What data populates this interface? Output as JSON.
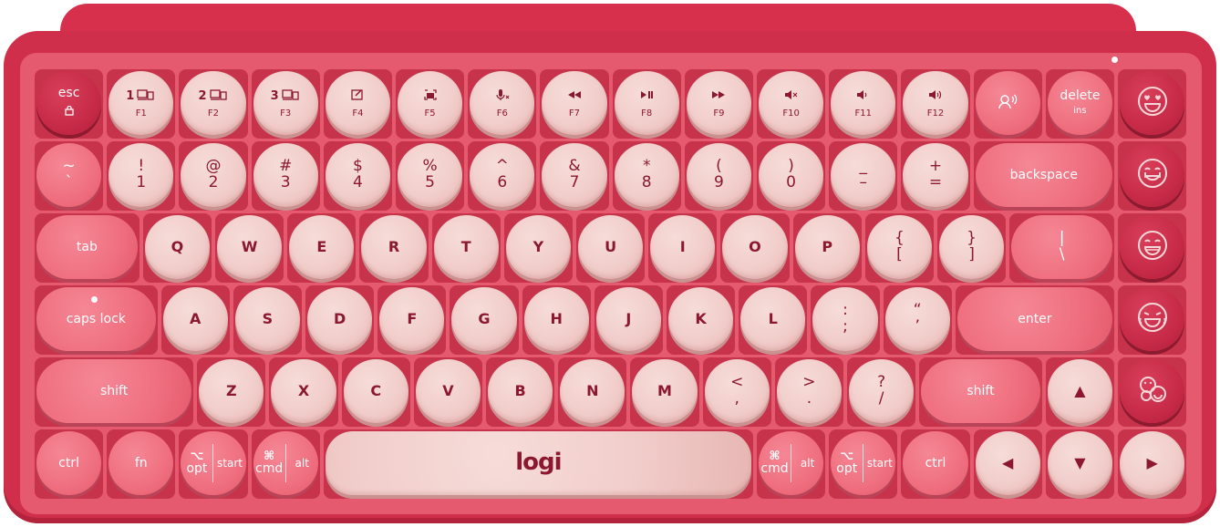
{
  "logo_text": "logi",
  "rows": [
    [
      {
        "id": "esc",
        "main": "esc",
        "sub": "",
        "icon": "lock-icon",
        "style": "dark",
        "w": 1
      },
      {
        "id": "f1",
        "main": "1",
        "sub": "F1",
        "icon": "device-icon",
        "style": "light",
        "w": 1
      },
      {
        "id": "f2",
        "main": "2",
        "sub": "F2",
        "icon": "device-icon",
        "style": "light",
        "w": 1
      },
      {
        "id": "f3",
        "main": "3",
        "sub": "F3",
        "icon": "device-icon",
        "style": "light",
        "w": 1
      },
      {
        "id": "f4",
        "main": "",
        "sub": "F4",
        "icon": "edit-icon",
        "style": "light",
        "w": 1
      },
      {
        "id": "f5",
        "main": "",
        "sub": "F5",
        "icon": "screenshot-icon",
        "style": "light",
        "w": 1
      },
      {
        "id": "f6",
        "main": "",
        "sub": "F6",
        "icon": "mic-mute-icon",
        "style": "light",
        "w": 1
      },
      {
        "id": "f7",
        "main": "",
        "sub": "F7",
        "icon": "rewind-icon",
        "style": "light",
        "w": 1
      },
      {
        "id": "f8",
        "main": "",
        "sub": "F8",
        "icon": "play-pause-icon",
        "style": "light",
        "w": 1
      },
      {
        "id": "f9",
        "main": "",
        "sub": "F9",
        "icon": "fast-forward-icon",
        "style": "light",
        "w": 1
      },
      {
        "id": "f10",
        "main": "",
        "sub": "F10",
        "icon": "mute-icon",
        "style": "light",
        "w": 1
      },
      {
        "id": "f11",
        "main": "",
        "sub": "F11",
        "icon": "volume-down-icon",
        "style": "light",
        "w": 1
      },
      {
        "id": "f12",
        "main": "",
        "sub": "F12",
        "icon": "volume-up-icon",
        "style": "light",
        "w": 1
      },
      {
        "id": "dictation",
        "main": "",
        "sub": "",
        "icon": "dictation-icon",
        "style": "coral",
        "w": 1
      },
      {
        "id": "delete",
        "main": "delete",
        "sub": "ins",
        "icon": "",
        "style": "coral",
        "w": 1
      },
      {
        "id": "emoji1",
        "main": "",
        "sub": "",
        "icon": "heart-eyes-emoji-icon",
        "style": "dark",
        "w": 1
      }
    ],
    [
      {
        "id": "tilde",
        "main": "~",
        "sub": "`",
        "style": "coral",
        "w": 1,
        "stack": true
      },
      {
        "id": "k1",
        "main": "!",
        "sub": "1",
        "style": "light",
        "w": 1,
        "stack": true
      },
      {
        "id": "k2",
        "main": "@",
        "sub": "2",
        "style": "light",
        "w": 1,
        "stack": true
      },
      {
        "id": "k3",
        "main": "#",
        "sub": "3",
        "style": "light",
        "w": 1,
        "stack": true
      },
      {
        "id": "k4",
        "main": "$",
        "sub": "4",
        "style": "light",
        "w": 1,
        "stack": true
      },
      {
        "id": "k5",
        "main": "%",
        "sub": "5",
        "style": "light",
        "w": 1,
        "stack": true
      },
      {
        "id": "k6",
        "main": "^",
        "sub": "6",
        "style": "light",
        "w": 1,
        "stack": true
      },
      {
        "id": "k7",
        "main": "&",
        "sub": "7",
        "style": "light",
        "w": 1,
        "stack": true
      },
      {
        "id": "k8",
        "main": "*",
        "sub": "8",
        "style": "light",
        "w": 1,
        "stack": true
      },
      {
        "id": "k9",
        "main": "(",
        "sub": "9",
        "style": "light",
        "w": 1,
        "stack": true
      },
      {
        "id": "k0",
        "main": ")",
        "sub": "0",
        "style": "light",
        "w": 1,
        "stack": true
      },
      {
        "id": "minus",
        "main": "_",
        "sub": "–",
        "style": "light",
        "w": 1,
        "stack": true
      },
      {
        "id": "equal",
        "main": "+",
        "sub": "=",
        "style": "light",
        "w": 1,
        "stack": true
      },
      {
        "id": "backspace",
        "main": "backspace",
        "sub": "",
        "style": "coral",
        "w": 2
      },
      {
        "id": "emoji2",
        "main": "",
        "sub": "",
        "icon": "tear-smile-emoji-icon",
        "style": "dark",
        "w": 1
      }
    ],
    [
      {
        "id": "tab",
        "main": "tab",
        "sub": "",
        "style": "coral",
        "w": 1.5
      },
      {
        "id": "q",
        "main": "Q",
        "style": "light",
        "w": 1
      },
      {
        "id": "w",
        "main": "W",
        "style": "light",
        "w": 1
      },
      {
        "id": "e",
        "main": "E",
        "style": "light",
        "w": 1
      },
      {
        "id": "r",
        "main": "R",
        "style": "light",
        "w": 1
      },
      {
        "id": "t",
        "main": "T",
        "style": "light",
        "w": 1
      },
      {
        "id": "y",
        "main": "Y",
        "style": "light",
        "w": 1
      },
      {
        "id": "u",
        "main": "U",
        "style": "light",
        "w": 1
      },
      {
        "id": "i",
        "main": "I",
        "style": "light",
        "w": 1
      },
      {
        "id": "o",
        "main": "O",
        "style": "light",
        "w": 1
      },
      {
        "id": "p",
        "main": "P",
        "style": "light",
        "w": 1
      },
      {
        "id": "lbracket",
        "main": "{",
        "sub": "[",
        "style": "light",
        "w": 1,
        "stack": true
      },
      {
        "id": "rbracket",
        "main": "}",
        "sub": "]",
        "style": "light",
        "w": 1,
        "stack": true
      },
      {
        "id": "backslash",
        "main": "|",
        "sub": "\\",
        "style": "coral",
        "w": 1.5,
        "stack": true
      },
      {
        "id": "emoji3",
        "main": "",
        "sub": "",
        "icon": "grin-emoji-icon",
        "style": "dark",
        "w": 1
      }
    ],
    [
      {
        "id": "capslock",
        "main": "caps lock",
        "sub": "",
        "style": "coral",
        "w": 1.75
      },
      {
        "id": "a",
        "main": "A",
        "style": "light",
        "w": 1
      },
      {
        "id": "s",
        "main": "S",
        "style": "light",
        "w": 1
      },
      {
        "id": "d",
        "main": "D",
        "style": "light",
        "w": 1
      },
      {
        "id": "f",
        "main": "F",
        "style": "light",
        "w": 1
      },
      {
        "id": "g",
        "main": "G",
        "style": "light",
        "w": 1
      },
      {
        "id": "h",
        "main": "H",
        "style": "light",
        "w": 1
      },
      {
        "id": "j",
        "main": "J",
        "style": "light",
        "w": 1
      },
      {
        "id": "k",
        "main": "K",
        "style": "light",
        "w": 1
      },
      {
        "id": "l",
        "main": "L",
        "style": "light",
        "w": 1
      },
      {
        "id": "semicolon",
        "main": ":",
        "sub": ";",
        "style": "light",
        "w": 1,
        "stack": true
      },
      {
        "id": "quote",
        "main": "“",
        "sub": "’",
        "style": "light",
        "w": 1,
        "stack": true
      },
      {
        "id": "enter",
        "main": "enter",
        "sub": "",
        "style": "coral",
        "w": 2.25
      },
      {
        "id": "emoji4",
        "main": "",
        "sub": "",
        "icon": "joy-emoji-icon",
        "style": "dark",
        "w": 1
      }
    ],
    [
      {
        "id": "lshift",
        "main": "shift",
        "sub": "",
        "style": "coral",
        "w": 2.25
      },
      {
        "id": "z",
        "main": "Z",
        "style": "light",
        "w": 1
      },
      {
        "id": "x",
        "main": "X",
        "style": "light",
        "w": 1
      },
      {
        "id": "c",
        "main": "C",
        "style": "light",
        "w": 1
      },
      {
        "id": "v",
        "main": "V",
        "style": "light",
        "w": 1
      },
      {
        "id": "b",
        "main": "B",
        "style": "light",
        "w": 1
      },
      {
        "id": "n",
        "main": "N",
        "style": "light",
        "w": 1
      },
      {
        "id": "m",
        "main": "M",
        "style": "light",
        "w": 1
      },
      {
        "id": "comma",
        "main": "<",
        "sub": ",",
        "style": "light",
        "w": 1,
        "stack": true
      },
      {
        "id": "period",
        "main": ">",
        "sub": ".",
        "style": "light",
        "w": 1,
        "stack": true
      },
      {
        "id": "slash",
        "main": "?",
        "sub": "/",
        "style": "light",
        "w": 1,
        "stack": true
      },
      {
        "id": "rshift",
        "main": "shift",
        "sub": "",
        "style": "coral",
        "w": 1.75
      },
      {
        "id": "up",
        "main": "▲",
        "sub": "",
        "style": "light",
        "w": 1
      },
      {
        "id": "emoji5",
        "main": "",
        "sub": "",
        "icon": "emoji-picker-icon",
        "style": "dark",
        "w": 1
      }
    ],
    [
      {
        "id": "lctrl",
        "main": "ctrl",
        "style": "coral",
        "w": 1
      },
      {
        "id": "fn",
        "main": "fn",
        "style": "coral",
        "w": 1
      },
      {
        "id": "lopt",
        "main": "opt",
        "alt2": "start",
        "sym": "⌥",
        "style": "coral",
        "w": 1,
        "split": true
      },
      {
        "id": "lcmd",
        "main": "cmd",
        "alt2": "alt",
        "sym": "⌘",
        "style": "coral",
        "w": 1,
        "split": true
      },
      {
        "id": "space",
        "main": "logi",
        "style": "light",
        "w": 6
      },
      {
        "id": "rcmd",
        "main": "cmd",
        "alt2": "alt",
        "sym": "⌘",
        "style": "coral",
        "w": 1,
        "split": true
      },
      {
        "id": "ropt",
        "main": "opt",
        "alt2": "start",
        "sym": "⌥",
        "style": "coral",
        "w": 1,
        "split": true
      },
      {
        "id": "rctrl",
        "main": "ctrl",
        "style": "coral",
        "w": 1
      },
      {
        "id": "left",
        "main": "◀",
        "style": "light",
        "w": 1
      },
      {
        "id": "down",
        "main": "▼",
        "style": "light",
        "w": 1
      },
      {
        "id": "right",
        "main": "▶",
        "style": "light",
        "w": 1
      }
    ]
  ],
  "colors": {
    "shell": "#cf2f4a",
    "deck": "#e65a70",
    "key_light": "#f1cdca",
    "key_coral": "#ef6f7f",
    "key_dark": "#c62a47",
    "legend": "#8c1830"
  }
}
